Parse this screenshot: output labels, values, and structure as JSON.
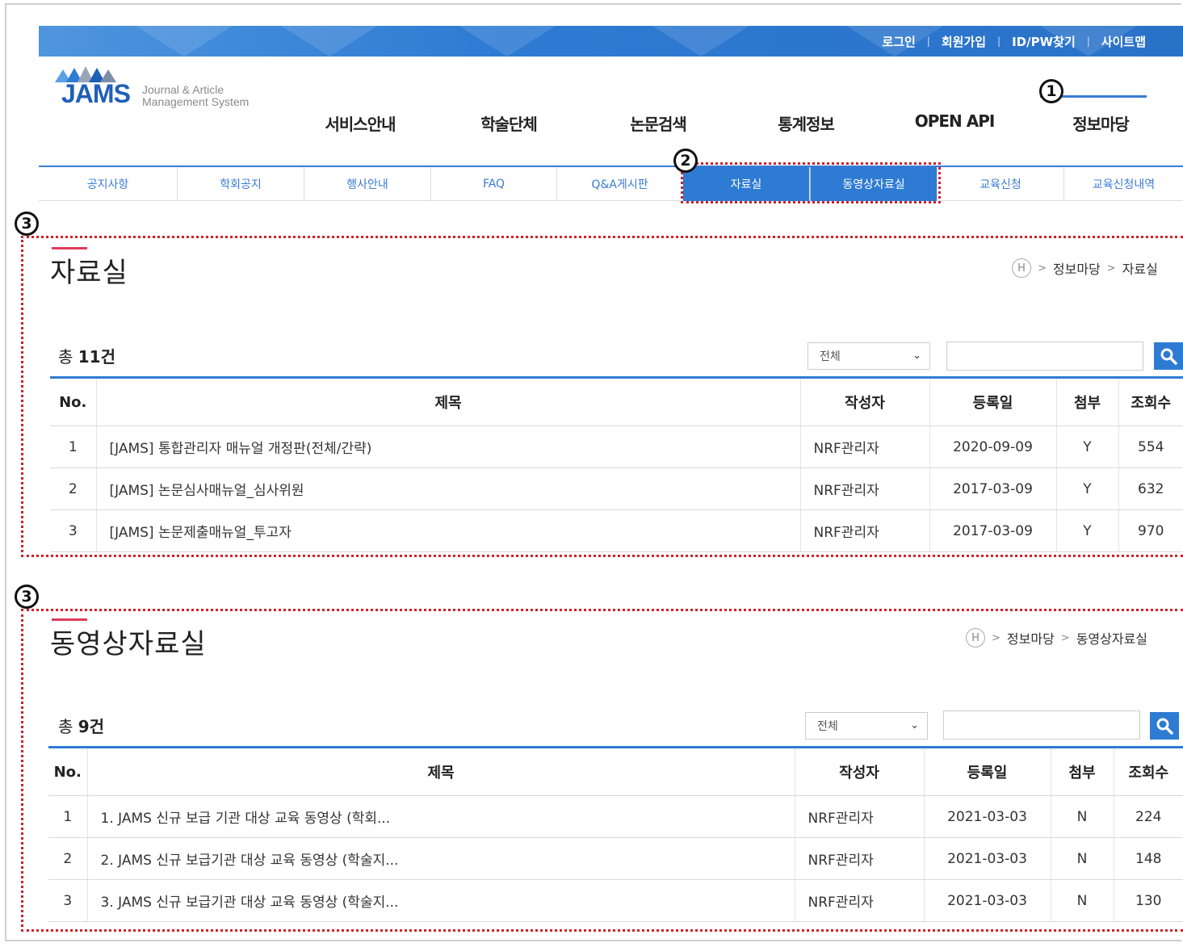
{
  "top_links": [
    "로그인",
    "회원가입",
    "ID/PW찾기",
    "사이트맵"
  ],
  "logo": {
    "brand": "JAMS",
    "sub1": "Journal & Article",
    "sub2": "Management System"
  },
  "gnb": [
    "서비스안내",
    "학술단체",
    "논문검색",
    "통계정보",
    "OPEN API",
    "정보마당"
  ],
  "lnb": [
    "공지사항",
    "학회공지",
    "행사안내",
    "FAQ",
    "Q&A게시판",
    "자료실",
    "동영상자료실",
    "교육신청",
    "교육신청내역"
  ],
  "badges": [
    "1",
    "2",
    "3",
    "3"
  ],
  "columns": [
    "No.",
    "제목",
    "작성자",
    "등록일",
    "첨부",
    "조회수"
  ],
  "sections": [
    {
      "title": "자료실",
      "breadcrumb": [
        "H",
        ">",
        "정보마당",
        ">",
        "자료실"
      ],
      "total_prefix": "총",
      "total_count": "11건",
      "select_value": "전체",
      "rows": [
        [
          "1",
          "[JAMS] 통합관리자 매뉴얼 개정판(전체/간략)",
          "NRF관리자",
          "2020-09-09",
          "Y",
          "554"
        ],
        [
          "2",
          "[JAMS] 논문심사매뉴얼_심사위원",
          "NRF관리자",
          "2017-03-09",
          "Y",
          "632"
        ],
        [
          "3",
          "[JAMS] 논문제출매뉴얼_투고자",
          "NRF관리자",
          "2017-03-09",
          "Y",
          "970"
        ]
      ]
    },
    {
      "title": "동영상자료실",
      "breadcrumb": [
        "H",
        ">",
        "정보마당",
        ">",
        "동영상자료실"
      ],
      "total_prefix": "총",
      "total_count": "9건",
      "select_value": "전체",
      "rows": [
        [
          "1",
          "1. JAMS 신규 보급 기관 대상 교육 동영상 (학회...",
          "NRF관리자",
          "2021-03-03",
          "N",
          "224"
        ],
        [
          "2",
          "2. JAMS 신규 보급기관 대상 교육 동영상 (학술지...",
          "NRF관리자",
          "2021-03-03",
          "N",
          "148"
        ],
        [
          "3",
          "3. JAMS 신규 보급기관 대상 교육 동영상 (학술지...",
          "NRF관리자",
          "2021-03-03",
          "N",
          "130"
        ]
      ]
    }
  ],
  "colors": {
    "accent": "#2e7bd3",
    "annotation": "#d0202a",
    "title_accent": "#e03a5a"
  }
}
